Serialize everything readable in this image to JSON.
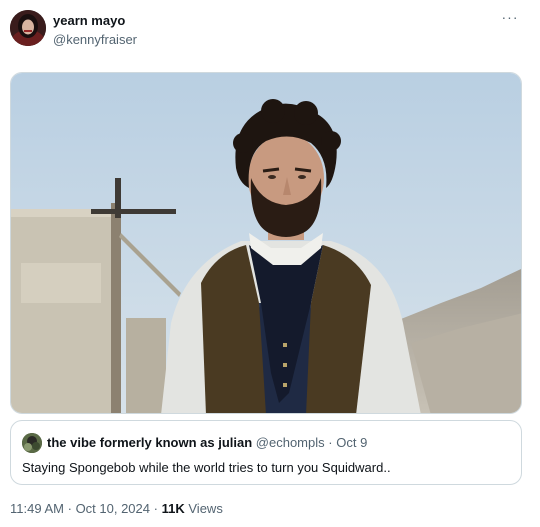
{
  "author": {
    "name": "yearn mayo",
    "handle": "@kennyfraiser"
  },
  "more_icon": "three-dots-icon",
  "more_label": "···",
  "quoted": {
    "name": "the vibe formerly known as julian",
    "handle": "@echompls",
    "separator": "·",
    "date": "Oct 9",
    "text": "Staying Spongebob while the world tries to turn you Squidward.."
  },
  "meta": {
    "time": "11:49 AM",
    "sep1": "·",
    "date": "Oct 10, 2024",
    "sep2": "·",
    "views_count": "11K",
    "views_label": "Views"
  },
  "colors": {
    "text_primary": "#0f1419",
    "text_secondary": "#536471",
    "border": "#cfd9de"
  }
}
